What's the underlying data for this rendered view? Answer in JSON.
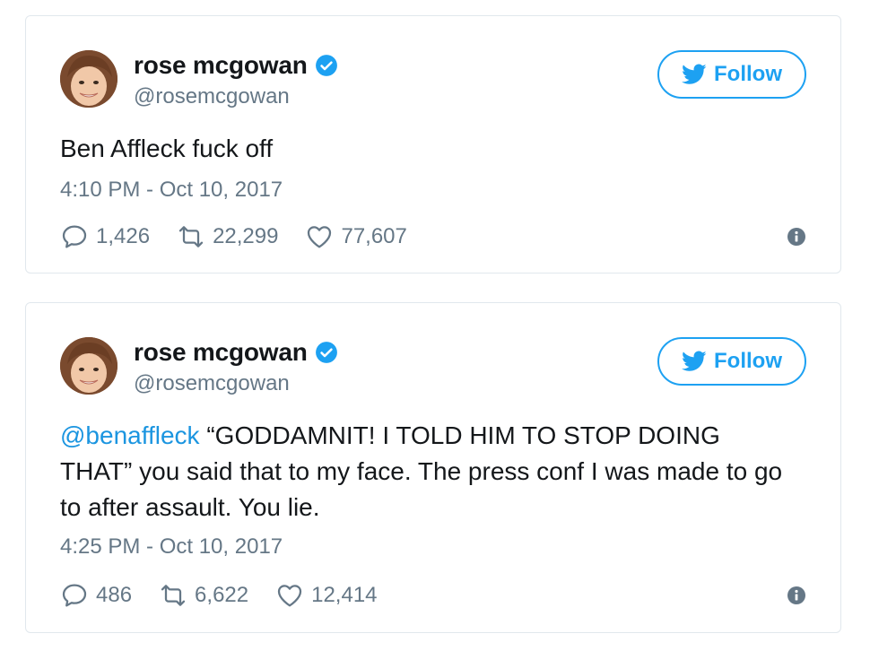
{
  "tweets": [
    {
      "author": {
        "name": "rose mcgowan",
        "handle": "@rosemcgowan"
      },
      "follow_label": "Follow",
      "text": "Ben Affleck fuck off",
      "timestamp": "4:10 PM - Oct 10, 2017",
      "stats": {
        "replies": "1,426",
        "retweets": "22,299",
        "likes": "77,607"
      }
    },
    {
      "author": {
        "name": "rose mcgowan",
        "handle": "@rosemcgowan"
      },
      "follow_label": "Follow",
      "mention": "@benaffleck",
      "text": " “GODDAMNIT! I TOLD HIM TO STOP DOING THAT” you said that to my face. The press conf I was made to go to after assault. You lie.",
      "timestamp": "4:25 PM - Oct 10, 2017",
      "stats": {
        "replies": "486",
        "retweets": "6,622",
        "likes": "12,414"
      }
    }
  ],
  "colors": {
    "accent": "#1da1f2",
    "mention": "#1b95e0",
    "muted": "#657786",
    "text": "#14171a",
    "border": "#e1e8ed"
  },
  "icons": [
    "verified-badge-icon",
    "twitter-bird-icon",
    "reply-icon",
    "retweet-icon",
    "like-icon",
    "info-icon"
  ]
}
